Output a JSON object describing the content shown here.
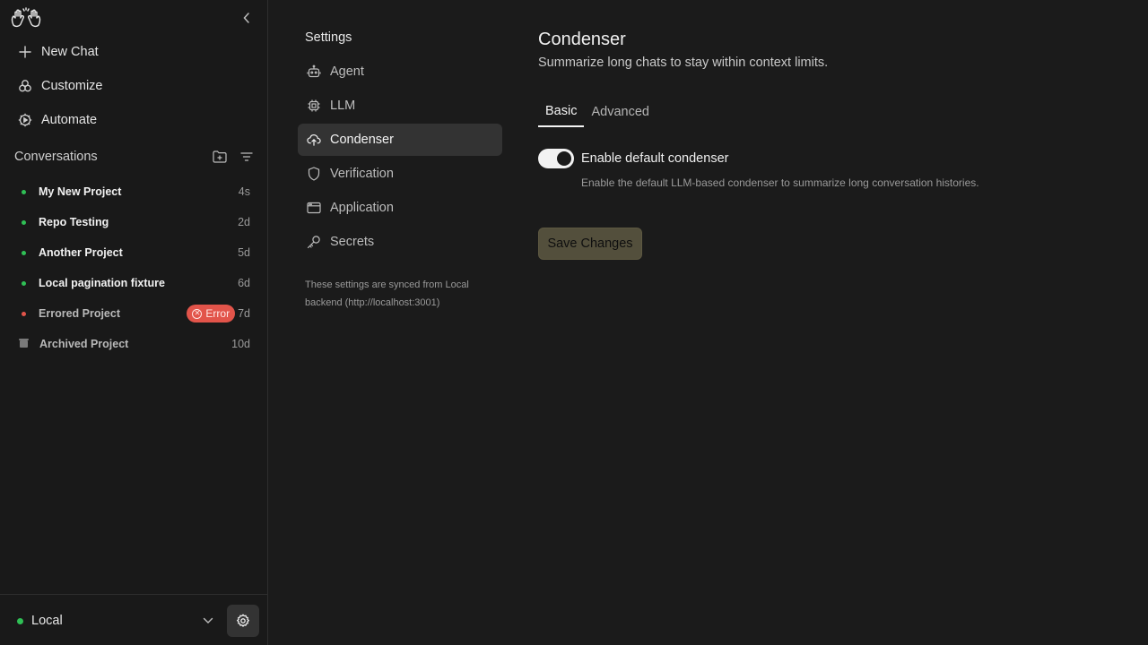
{
  "sidebar": {
    "nav": {
      "new_chat": "New Chat",
      "customize": "Customize",
      "automate": "Automate"
    },
    "conversations_title": "Conversations",
    "conversations": [
      {
        "name": "My New Project",
        "time": "4s",
        "status": "active"
      },
      {
        "name": "Repo Testing",
        "time": "2d",
        "status": "active"
      },
      {
        "name": "Another Project",
        "time": "5d",
        "status": "active"
      },
      {
        "name": "Local pagination fixture",
        "time": "6d",
        "status": "active"
      },
      {
        "name": "Errored Project",
        "time": "7d",
        "status": "error",
        "badge": "Error"
      },
      {
        "name": "Archived Project",
        "time": "10d",
        "status": "archived"
      }
    ],
    "backend": {
      "label": "Local",
      "status_color": "#2fbf55"
    }
  },
  "settings_nav": {
    "title": "Settings",
    "items": [
      {
        "label": "Agent",
        "icon": "robot-icon"
      },
      {
        "label": "LLM",
        "icon": "chip-icon"
      },
      {
        "label": "Condenser",
        "icon": "cloud-upload-icon",
        "active": true
      },
      {
        "label": "Verification",
        "icon": "shield-icon"
      },
      {
        "label": "Application",
        "icon": "window-icon"
      },
      {
        "label": "Secrets",
        "icon": "key-icon"
      }
    ],
    "sync_note": "These settings are synced from Local backend (http://localhost:3001)"
  },
  "main": {
    "title": "Condenser",
    "subtitle": "Summarize long chats to stay within context limits.",
    "tabs": [
      {
        "label": "Basic",
        "active": true
      },
      {
        "label": "Advanced",
        "active": false
      }
    ],
    "toggle": {
      "label": "Enable default condenser",
      "help": "Enable the default LLM-based condenser to summarize long conversation histories.",
      "enabled": true
    },
    "save_label": "Save Changes"
  },
  "colors": {
    "active_dot": "#2fbf55",
    "error_dot": "#e2544a",
    "error_badge": "#e2544a",
    "save_button": "#534f3c"
  }
}
